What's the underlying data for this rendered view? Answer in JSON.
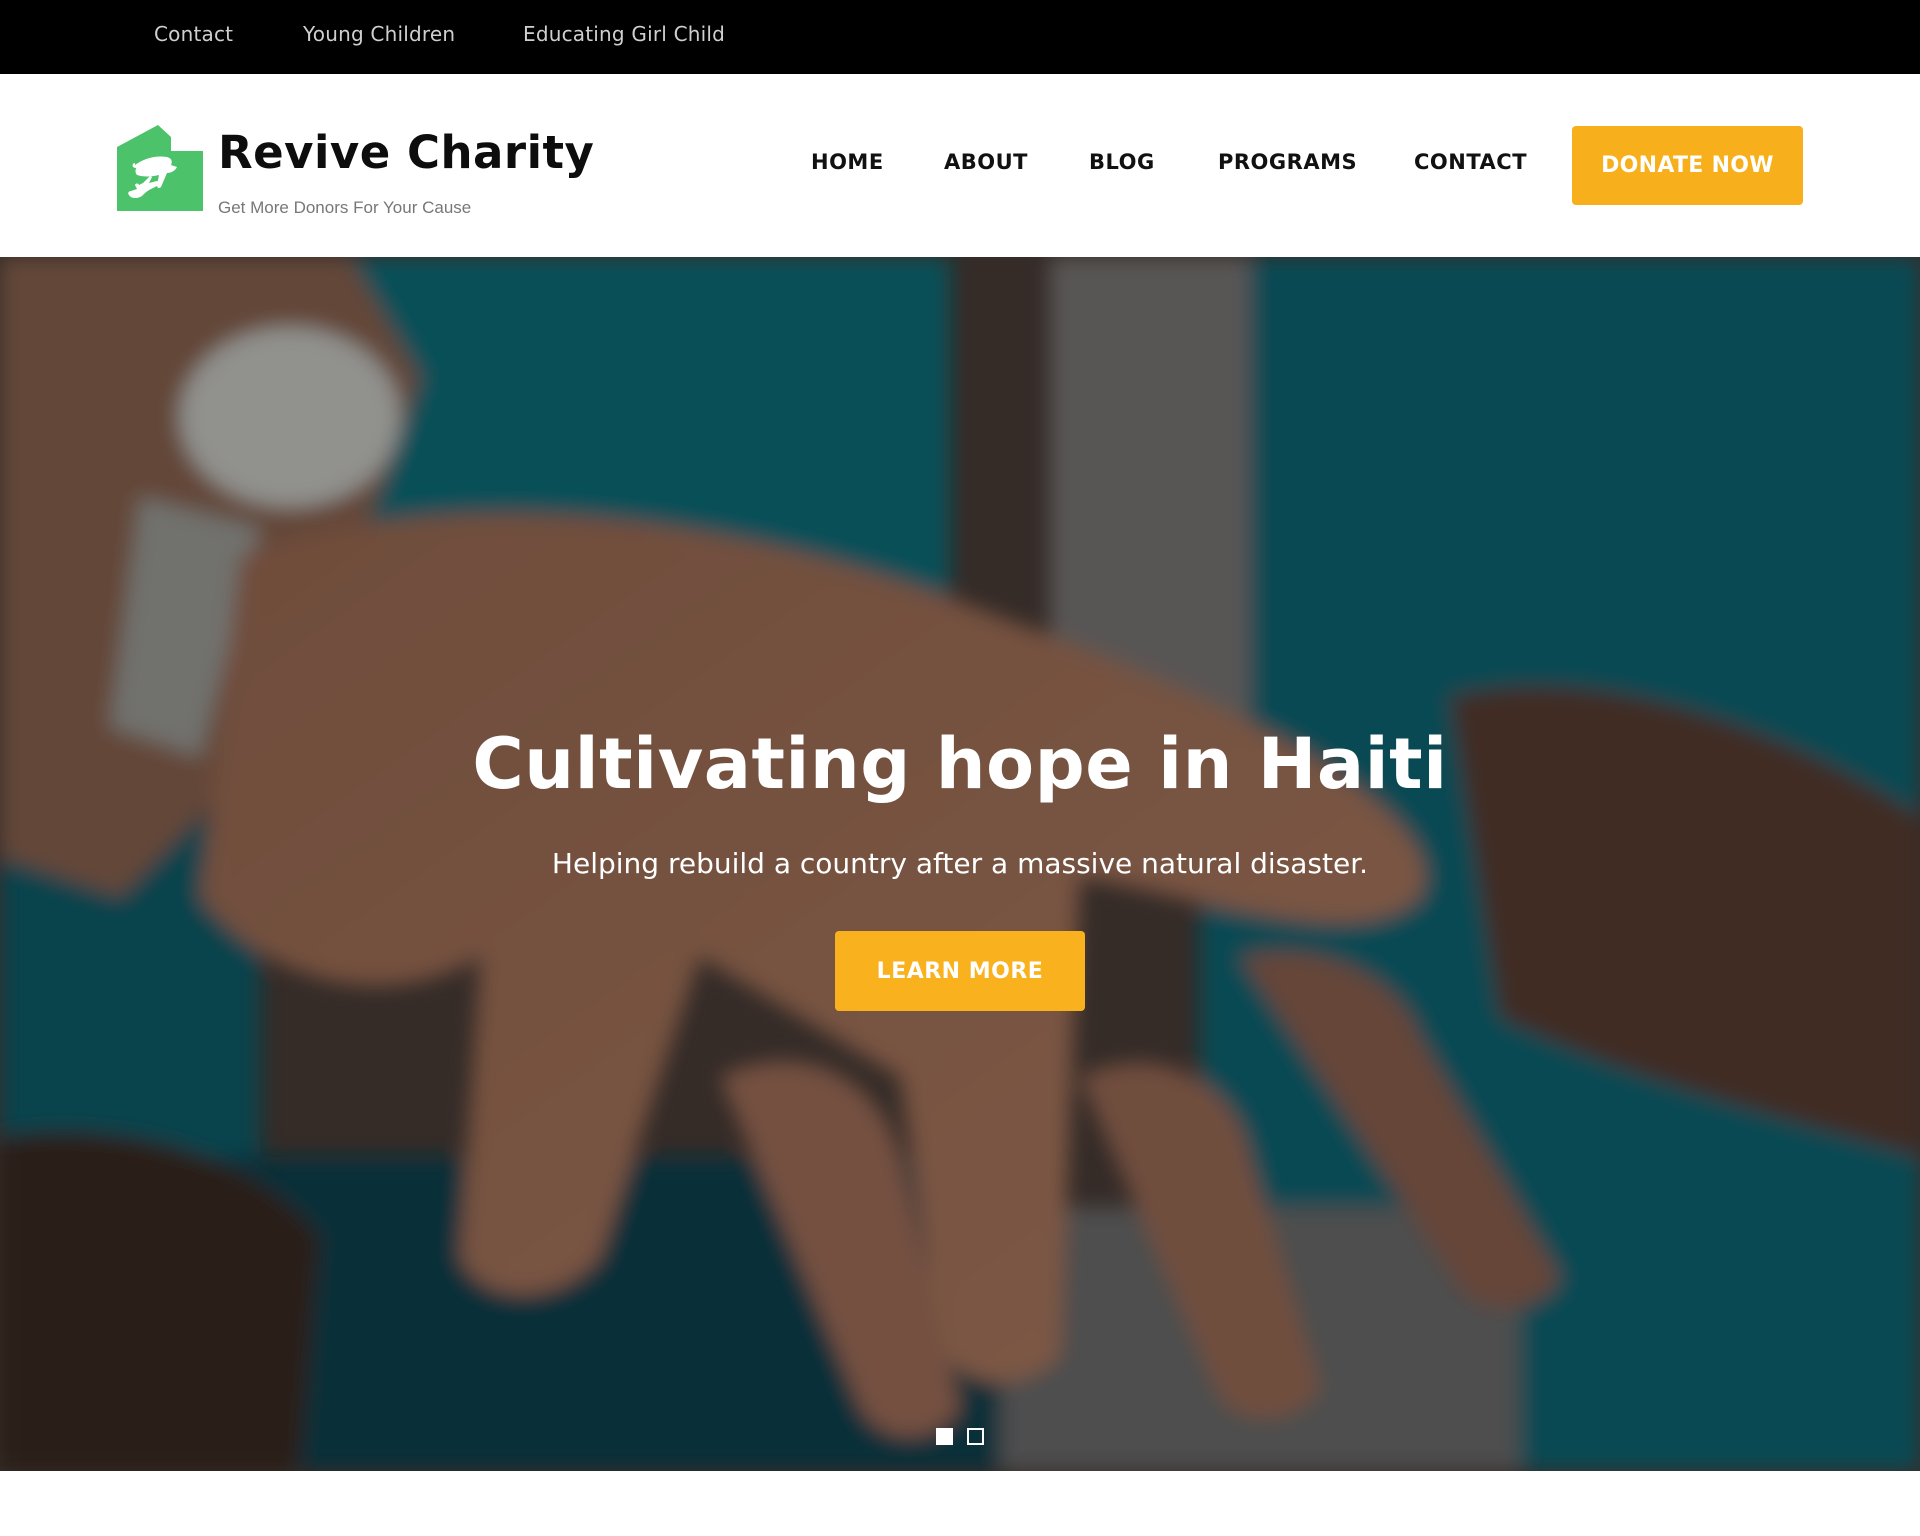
{
  "topbar": {
    "links": [
      "Contact",
      "Young Children",
      "Educating Girl Child"
    ]
  },
  "header": {
    "brand_name": "Revive Charity",
    "tagline": "Get More Donors For Your Cause",
    "logo_icon": "house-hands-icon",
    "nav": [
      "HOME",
      "ABOUT",
      "BLOG",
      "PROGRAMS",
      "CONTACT"
    ],
    "donate_label": "DONATE NOW"
  },
  "hero": {
    "title": "Cultivating hope in Haiti",
    "subtitle": "Helping rebuild a country after a massive natural disaster.",
    "cta_label": "LEARN MORE",
    "slides_total": 2,
    "active_slide": 1
  },
  "colors": {
    "accent": "#f7b01b",
    "brand_green": "#4cc26a",
    "topbar_bg": "#000000",
    "topbar_text": "#cfcfcf"
  }
}
